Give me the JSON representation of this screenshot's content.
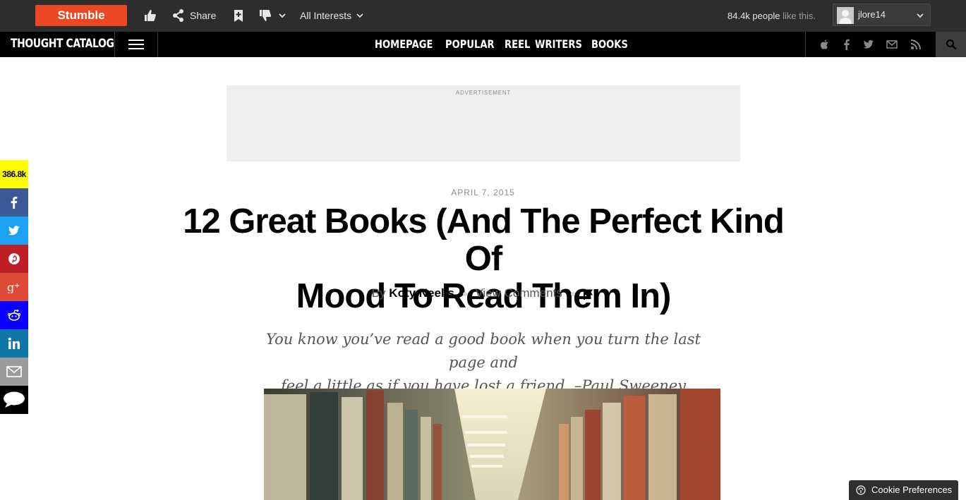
{
  "toolbar": {
    "stumble_label": "Stumble",
    "share_label": "Share",
    "interests_label": "All Interests",
    "people_count": "84.4k people",
    "people_suffix": "like this.",
    "username": "jlore14",
    "stumble_color": "#eb4924",
    "icons": [
      "thumbs-up-icon",
      "share-icon",
      "bookmark-icon",
      "thumbs-down-icon",
      "chevron-down-icon"
    ]
  },
  "site": {
    "logo": "THOUGHT CATALOG",
    "nav_links": [
      "HOMEPAGE",
      "POPULAR",
      "REEL",
      "WRITERS",
      "BOOKS"
    ],
    "social_icons": [
      "apple-icon",
      "facebook-icon",
      "twitter-icon",
      "email-icon",
      "rss-icon",
      "search-icon"
    ]
  },
  "ad": {
    "label": "ADVERTISEMENT"
  },
  "share_rail": {
    "count": "386.8k",
    "count_color": "#ffff00",
    "items": [
      {
        "icon": "facebook-icon",
        "color": "#3b5998"
      },
      {
        "icon": "twitter-icon",
        "color": "#1da1f2"
      },
      {
        "icon": "pinterest-icon",
        "color": "#bd2126"
      },
      {
        "icon": "google-plus-icon",
        "color": "#dc4a38"
      },
      {
        "icon": "reddit-icon",
        "color": "#0a00ff"
      },
      {
        "icon": "linkedin-icon",
        "color": "#0e76a8"
      },
      {
        "icon": "email-icon",
        "color": "#9b9b9b"
      },
      {
        "icon": "comment-icon",
        "color": "#000000"
      }
    ]
  },
  "article": {
    "date": "APRIL 7, 2015",
    "title_line1": "12 Great Books (And The Perfect Kind Of",
    "title_line2": "Mood To Read Them In)",
    "by": "By",
    "author": "Koty Neelis",
    "comments_label": "View Comments",
    "quote_line1": "You know you’ve read a good book when you turn the last page and",
    "quote_line2": "feel a little as if you have lost a friend. –Paul Sweeney"
  },
  "cookie": {
    "label": "Cookie Preferences"
  }
}
